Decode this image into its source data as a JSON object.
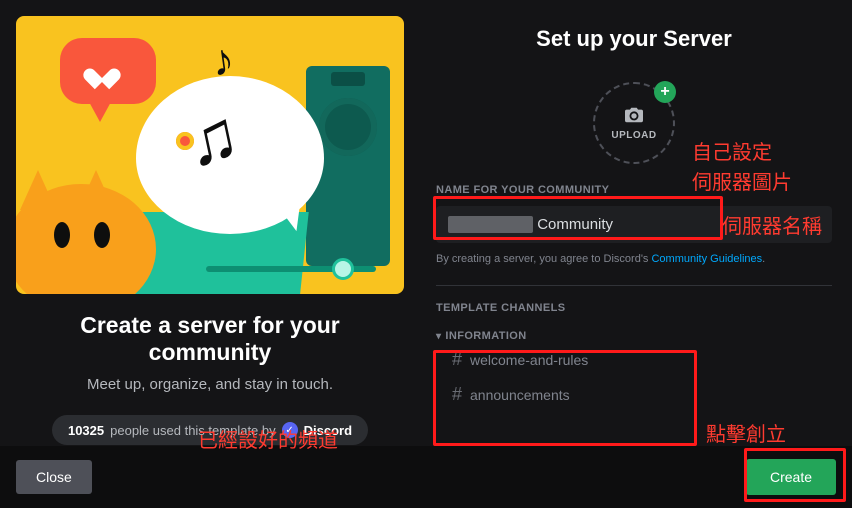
{
  "left": {
    "heading": "Create a server for your community",
    "sub": "Meet up, organize, and stay in touch.",
    "template_count": "10325",
    "template_text": "people used this template by",
    "template_by": "Discord"
  },
  "right": {
    "heading": "Set up your Server",
    "upload_label": "UPLOAD",
    "name_label": "NAME FOR YOUR COMMUNITY",
    "name_value_suffix": "Community",
    "tos_prefix": "By creating a server, you agree to Discord's ",
    "tos_link": "Community Guidelines",
    "tos_suffix": ".",
    "template_channels_label": "TEMPLATE CHANNELS",
    "group": {
      "label": "INFORMATION",
      "channels": [
        "welcome-and-rules",
        "announcements"
      ]
    }
  },
  "footer": {
    "close": "Close",
    "create": "Create"
  },
  "annotations": {
    "a1": "自己設定",
    "a2": "伺服器圖片",
    "a3": "伺服器名稱",
    "a4": "已經設好的頻道",
    "a5": "點擊創立"
  }
}
